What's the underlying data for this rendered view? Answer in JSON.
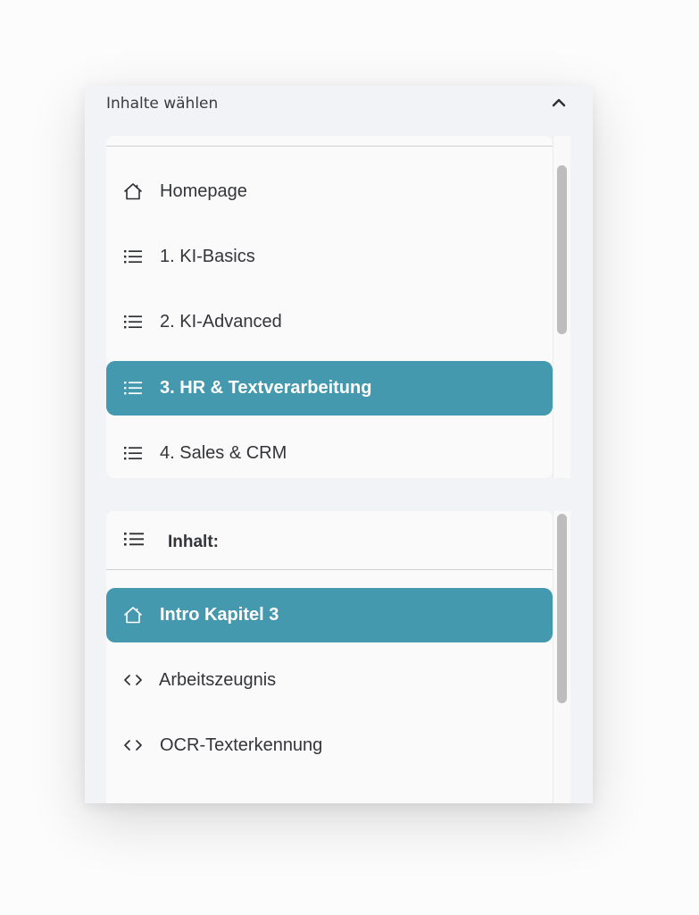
{
  "header": {
    "title": "Inhalte wählen",
    "collapse_icon": "chevron-up-icon"
  },
  "course_nav": {
    "items": [
      {
        "label": "Homepage",
        "icon": "home-icon",
        "active": false
      },
      {
        "label": "1. KI-Basics",
        "icon": "list-icon",
        "active": false
      },
      {
        "label": "2. KI-Advanced",
        "icon": "list-icon",
        "active": false
      },
      {
        "label": "3. HR & Textverarbeitung",
        "icon": "list-icon",
        "active": true
      },
      {
        "label": "4. Sales & CRM",
        "icon": "list-icon",
        "active": false
      }
    ]
  },
  "contents": {
    "heading": "Inhalt:",
    "heading_icon": "list-icon",
    "items": [
      {
        "label": "Intro Kapitel 3",
        "icon": "home-icon",
        "active": true
      },
      {
        "label": "Arbeitszeugnis",
        "icon": "code-icon",
        "active": false
      },
      {
        "label": "OCR-Texterkennung",
        "icon": "code-icon",
        "active": false
      }
    ]
  },
  "colors": {
    "accent": "#4499ae",
    "panel_bg": "#f2f3f7",
    "card_bg": "#fafafa",
    "text": "#34353a"
  }
}
